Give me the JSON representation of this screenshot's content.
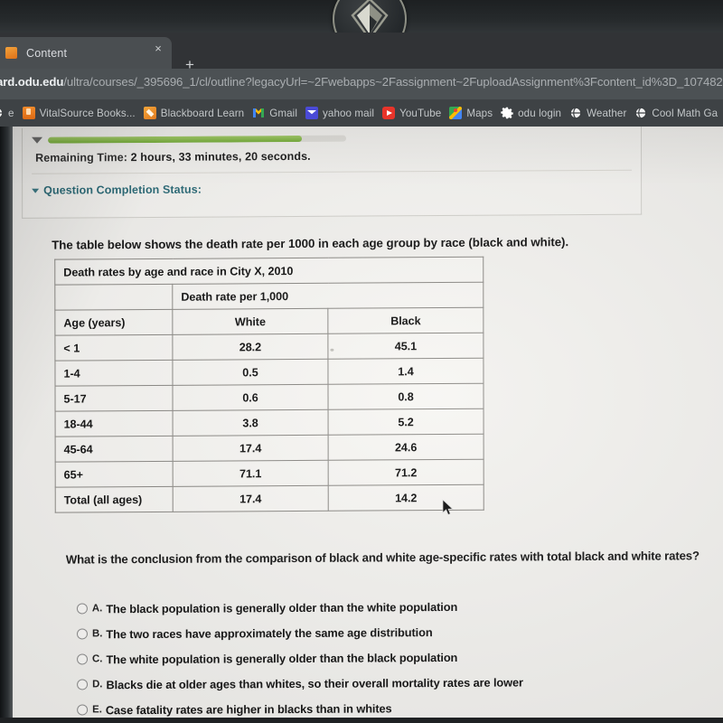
{
  "browser": {
    "tab": {
      "title": "Content",
      "close_label": "×",
      "favicon": "blackboard-favicon"
    },
    "new_tab_label": "+",
    "url_bold": "oard.odu.edu",
    "url_rest": "/ultra/courses/_395696_1/cl/outline?legacyUrl=~2Fwebapps~2Fassignment~2FuploadAssignment%3Fcontent_id%3D_107482",
    "bookmarks": [
      {
        "label": "e",
        "icon": "globe-icon"
      },
      {
        "label": "VitalSource Books...",
        "icon": "vitalsource-icon"
      },
      {
        "label": "Blackboard Learn",
        "icon": "blackboard-icon"
      },
      {
        "label": "Gmail",
        "icon": "gmail-icon"
      },
      {
        "label": "yahoo mail",
        "icon": "yahoo-mail-icon"
      },
      {
        "label": "YouTube",
        "icon": "youtube-icon"
      },
      {
        "label": "Maps",
        "icon": "google-maps-icon"
      },
      {
        "label": "odu login",
        "icon": "gear-icon"
      },
      {
        "label": "Weather",
        "icon": "globe-icon"
      },
      {
        "label": "Cool Math Ga",
        "icon": "globe-icon"
      }
    ]
  },
  "timer": {
    "progress_percent": 85,
    "remaining_lead": "Remaining Time:",
    "remaining_value": "2 hours, 33 minutes, 20 seconds.",
    "completion_status_label": "Question Completion Status:"
  },
  "question": {
    "intro": "The table below shows the death rate per 1000 in each age group by race (black and white).",
    "stem": "What is the conclusion from the comparison of black and white age-specific rates with total black and white rates?",
    "options": [
      {
        "letter": "A.",
        "text": "The black population is generally older than the white population",
        "selected": false
      },
      {
        "letter": "B.",
        "text": "The two races have approximately the same age distribution",
        "selected": false
      },
      {
        "letter": "C.",
        "text": "The white population is generally older than the black population",
        "selected": false
      },
      {
        "letter": "D.",
        "text": "Blacks die at older ages than whites, so their overall mortality rates are lower",
        "selected": false
      },
      {
        "letter": "E.",
        "text": "Case fatality rates are higher in blacks than in whites",
        "selected": false
      }
    ]
  },
  "chart_data": {
    "type": "table",
    "title": "Death rates by age and race in City X, 2010",
    "spanning_header": "Death rate per 1,000",
    "columns": [
      "Age (years)",
      "White",
      "Black"
    ],
    "categories": [
      "< 1",
      "1-4",
      "5-17",
      "18-44",
      "45-64",
      "65+",
      "Total (all ages)"
    ],
    "series": [
      {
        "name": "White",
        "values": [
          28.2,
          0.5,
          0.6,
          3.8,
          17.4,
          71.1,
          17.4
        ]
      },
      {
        "name": "Black",
        "values": [
          45.1,
          1.4,
          0.8,
          5.2,
          24.6,
          71.2,
          14.2
        ]
      }
    ],
    "rows": [
      [
        "< 1",
        "28.2",
        "45.1"
      ],
      [
        "1-4",
        "0.5",
        "1.4"
      ],
      [
        "5-17",
        "0.6",
        "0.8"
      ],
      [
        "18-44",
        "3.8",
        "5.2"
      ],
      [
        "45-64",
        "17.4",
        "24.6"
      ],
      [
        "65+",
        "71.1",
        "71.2"
      ],
      [
        "Total (all ages)",
        "17.4",
        "14.2"
      ]
    ],
    "ylabel": "Death rate per 1,000",
    "xlabel": "Age (years)"
  },
  "colors": {
    "progress_green": "#79b23c",
    "link_teal": "#2b6b78",
    "chrome_dark": "#3c4043",
    "page_bg": "#f3f2ef"
  }
}
